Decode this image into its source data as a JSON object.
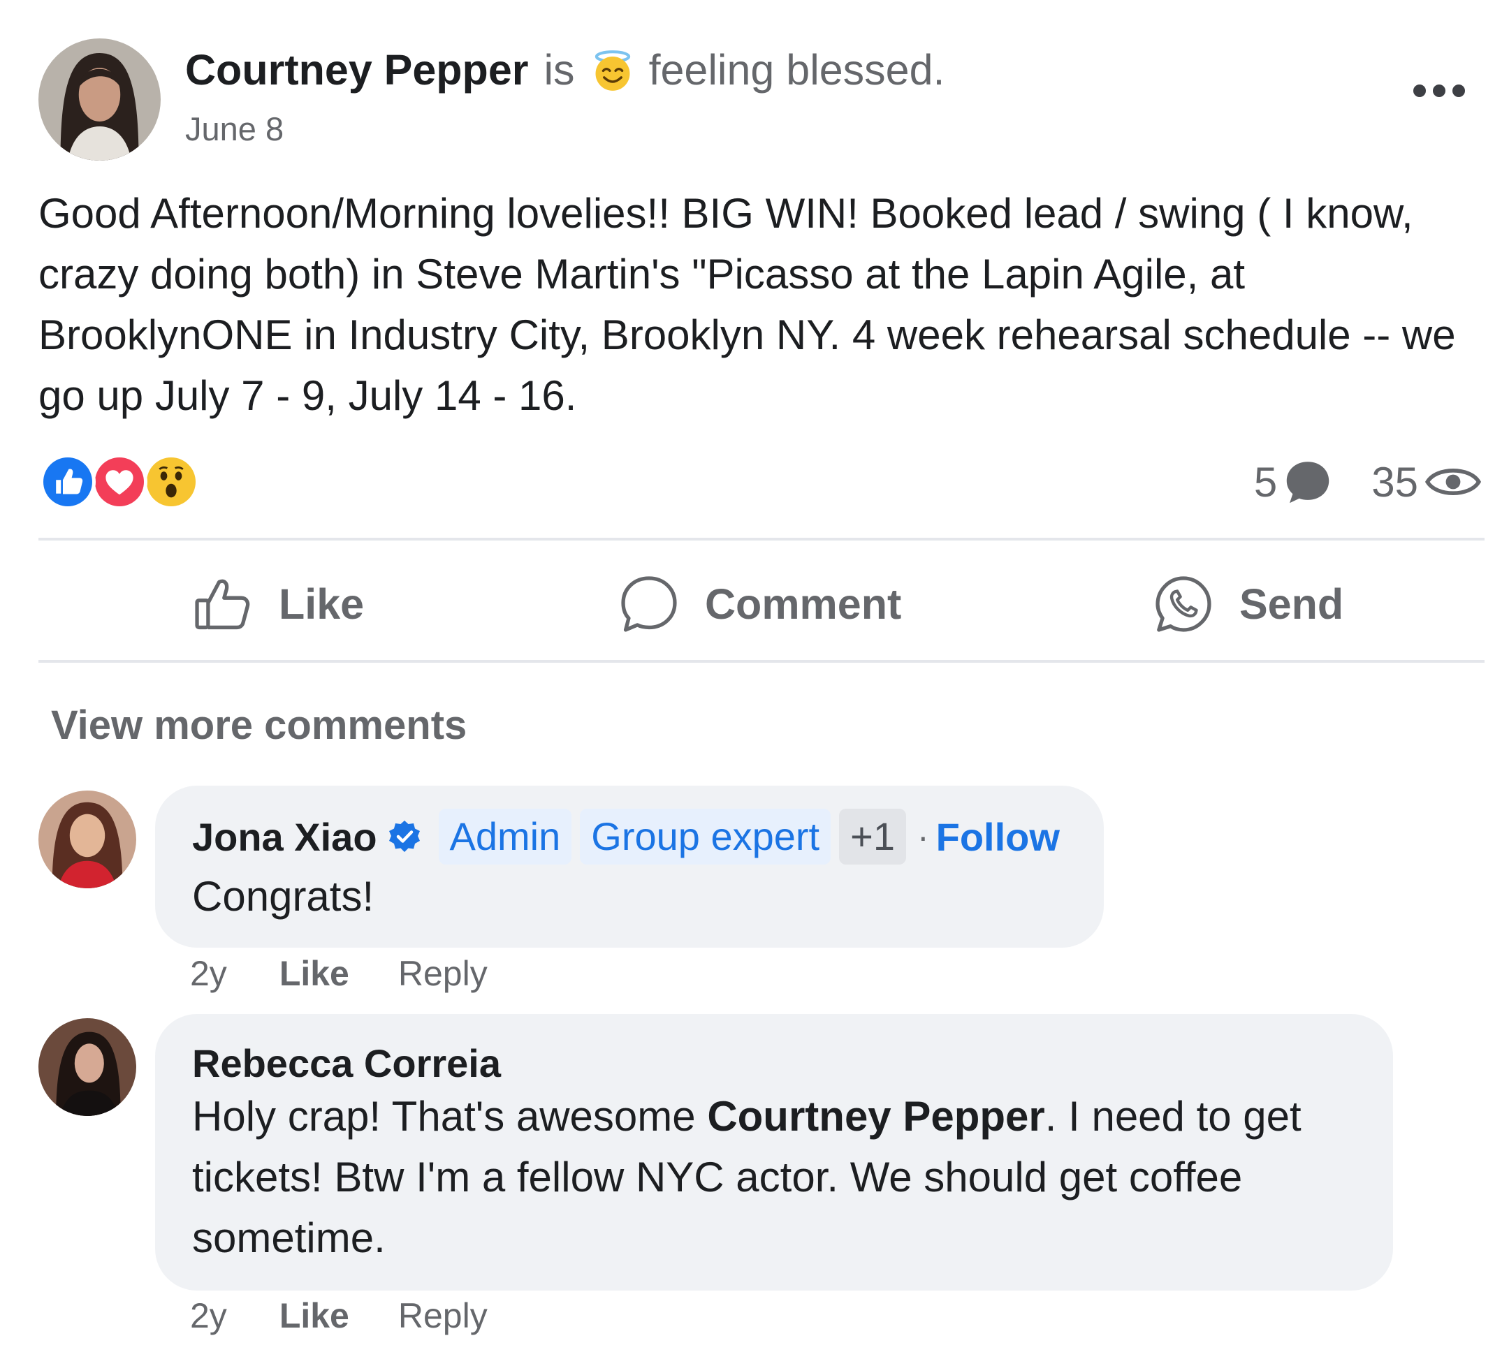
{
  "post": {
    "author": "Courtney Pepper",
    "is_text": "is",
    "feeling_icon": "halo-smile-emoji",
    "feeling": "feeling blessed.",
    "date": "June 8",
    "body": "Good Afternoon/Morning lovelies!! BIG WIN! Booked lead / swing ( I know, crazy doing  both) in Steve Martin's \"Picasso at the Lapin Agile, at BrooklynONE in Industry City, Brooklyn NY.  4 week rehearsal schedule -- we go up July 7 - 9, July 14 - 16.",
    "reactions": [
      "like",
      "love",
      "wow"
    ],
    "comment_count": "5",
    "view_count": "35"
  },
  "actions": {
    "like": "Like",
    "comment": "Comment",
    "send": "Send"
  },
  "view_more": "View more comments",
  "comments": [
    {
      "name": "Jona Xiao",
      "verified": true,
      "badges": [
        "Admin",
        "Group expert",
        "+1"
      ],
      "follow": "Follow",
      "separator": "·",
      "text": "Congrats!",
      "time": "2y",
      "like": "Like",
      "reply": "Reply"
    },
    {
      "name": "Rebecca Correia",
      "text_before": "Holy crap! That's awesome ",
      "mention": "Courtney Pepper",
      "text_after": ". I need to get tickets! Btw I'm a fellow NYC actor. We should get coffee sometime.",
      "time": "2y",
      "like": "Like",
      "reply": "Reply"
    }
  ],
  "colors": {
    "link_blue": "#1b74e4",
    "secondary_text": "#65676b",
    "bubble_bg": "#f0f2f5"
  }
}
